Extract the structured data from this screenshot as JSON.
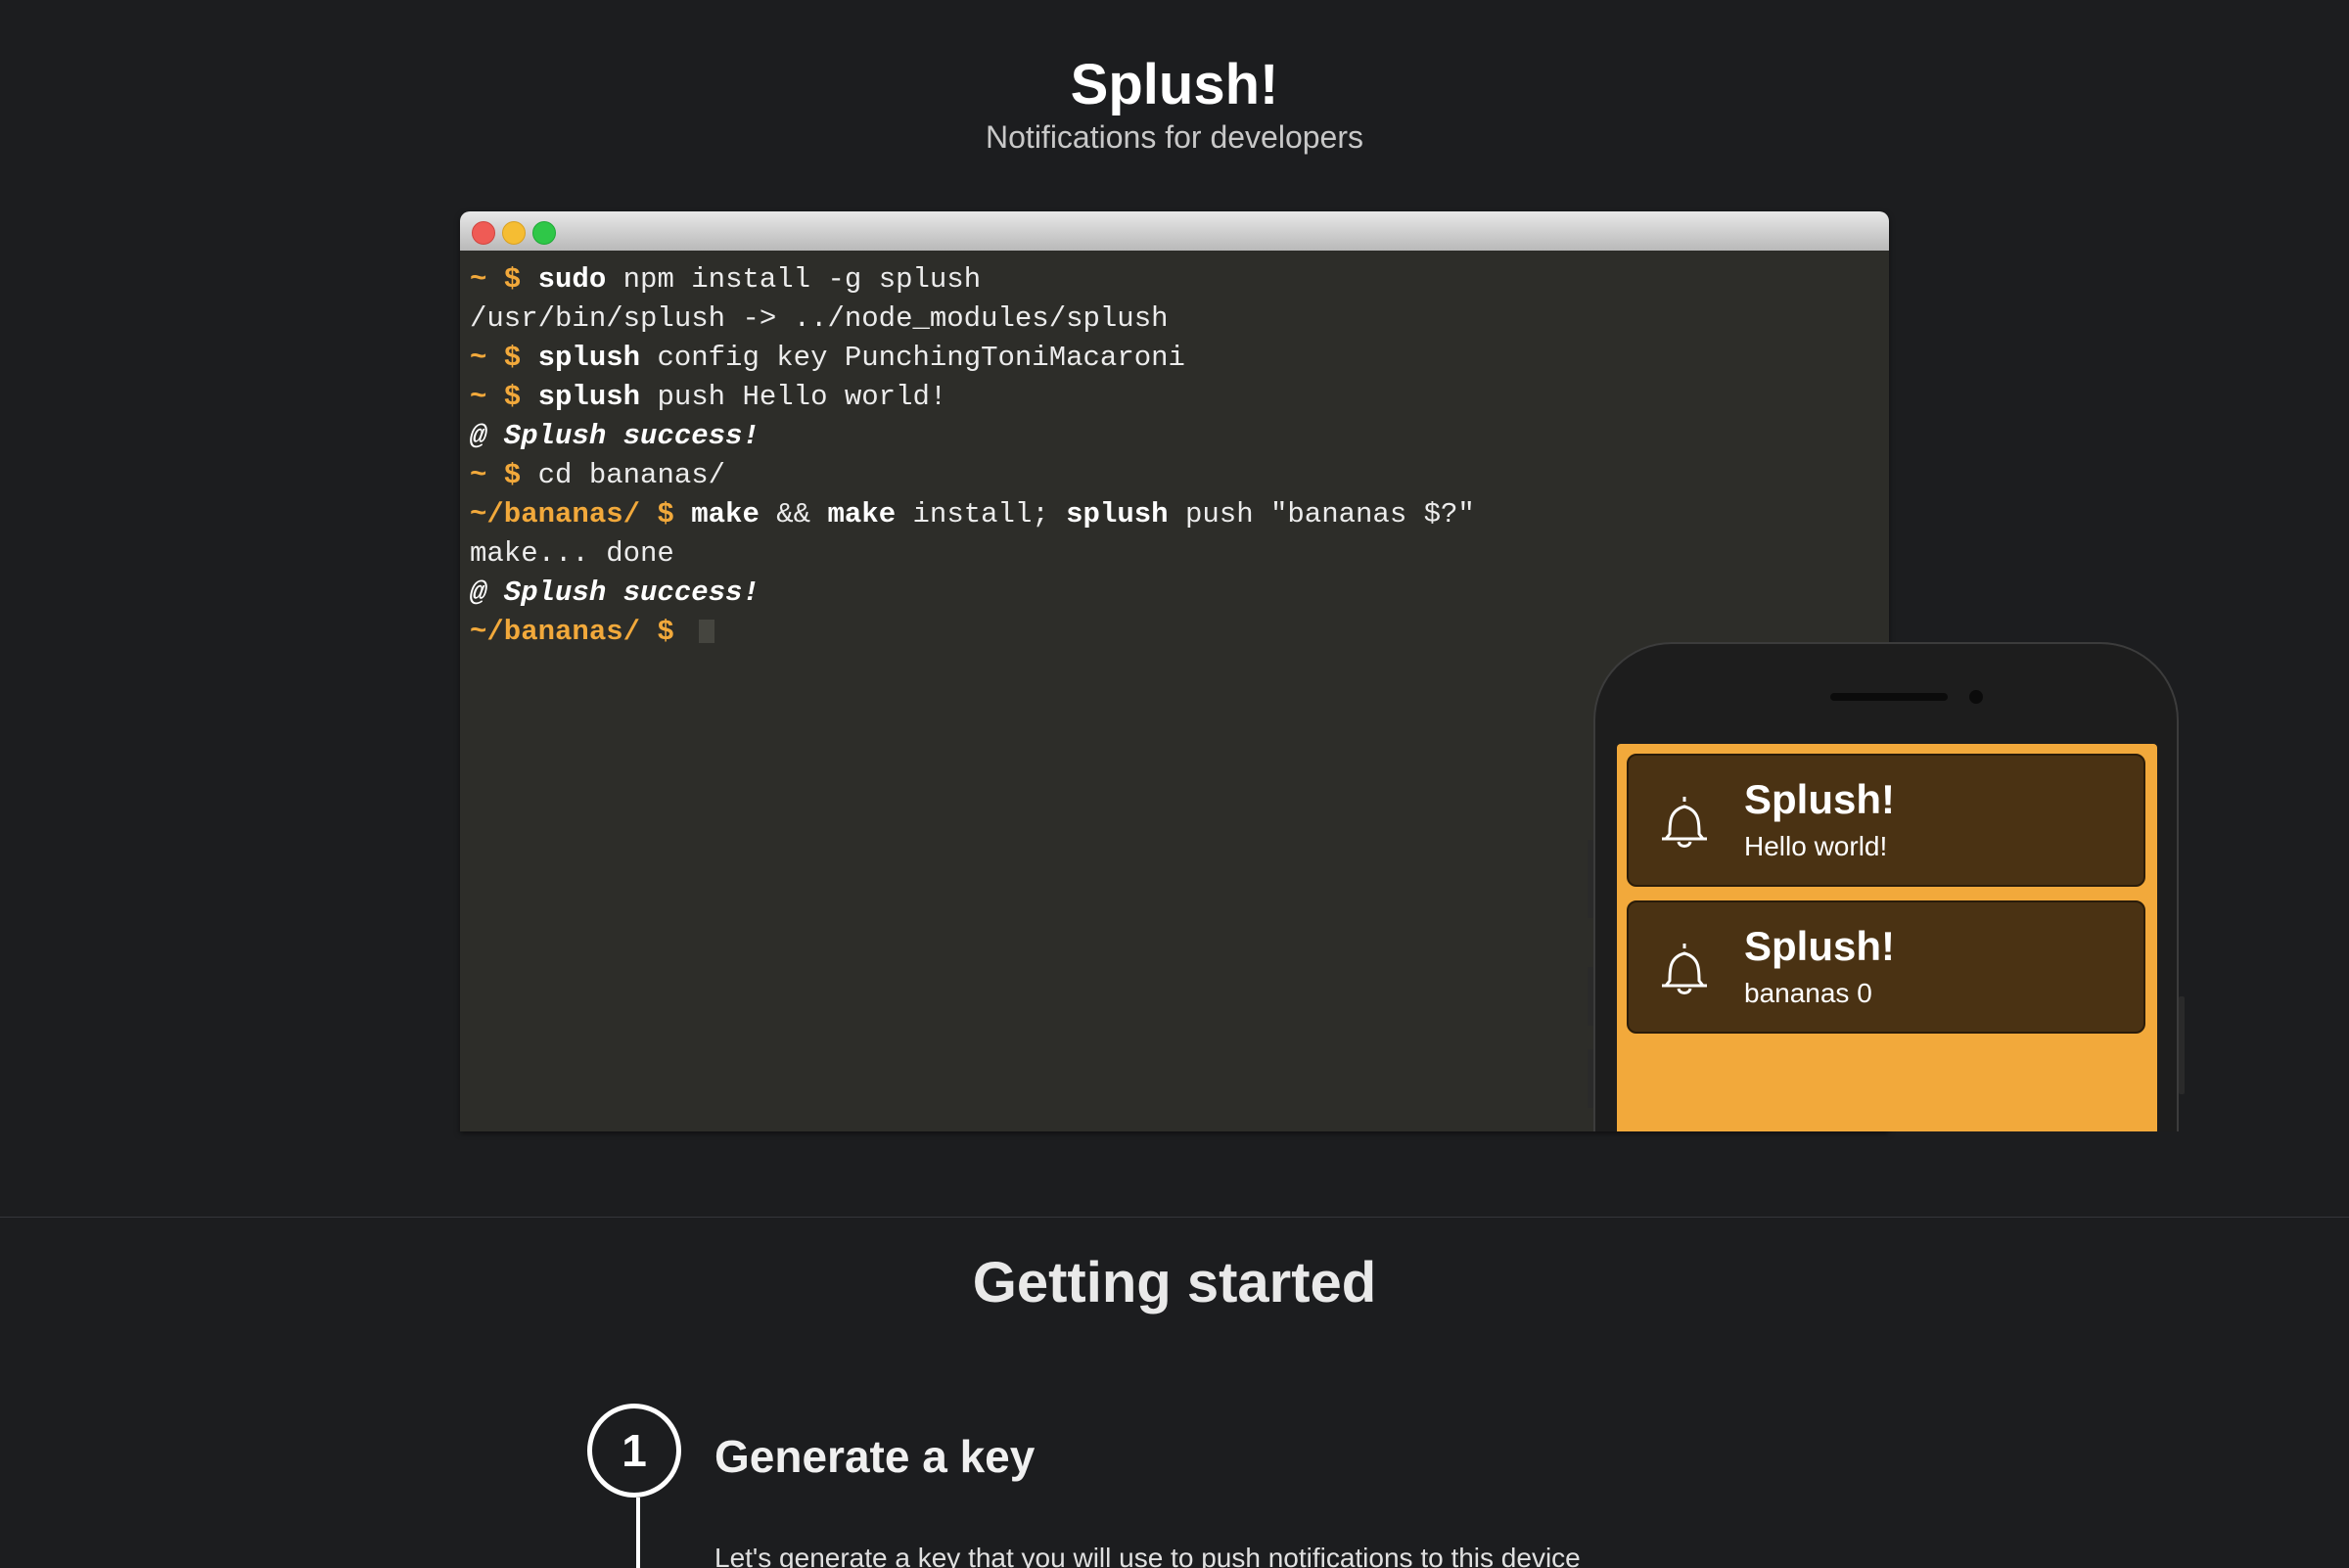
{
  "header": {
    "title": "Splush!",
    "subtitle": "Notifications for developers"
  },
  "terminal": {
    "lines": [
      [
        {
          "k": "prompt",
          "t": "~ $ "
        },
        {
          "k": "cmd",
          "t": "sudo"
        },
        {
          "k": "arg",
          "t": " npm install -g splush"
        }
      ],
      [
        {
          "k": "out",
          "t": "/usr/bin/splush -> ../node_modules/splush"
        }
      ],
      [
        {
          "k": "prompt",
          "t": "~ $ "
        },
        {
          "k": "cmd",
          "t": "splush"
        },
        {
          "k": "arg",
          "t": " config key PunchingToniMacaroni"
        }
      ],
      [
        {
          "k": "prompt",
          "t": "~ $ "
        },
        {
          "k": "cmd",
          "t": "splush"
        },
        {
          "k": "arg",
          "t": " push Hello world!"
        }
      ],
      [
        {
          "k": "success",
          "t": "@ Splush success!"
        }
      ],
      [
        {
          "k": "prompt",
          "t": "~ $ "
        },
        {
          "k": "arg",
          "t": "cd bananas/"
        }
      ],
      [
        {
          "k": "prompt",
          "t": "~/bananas/ $ "
        },
        {
          "k": "cmd",
          "t": "make"
        },
        {
          "k": "arg",
          "t": " && "
        },
        {
          "k": "cmd",
          "t": "make"
        },
        {
          "k": "arg",
          "t": " install; "
        },
        {
          "k": "cmd",
          "t": "splush"
        },
        {
          "k": "arg",
          "t": " push \"bananas $?\""
        }
      ],
      [
        {
          "k": "out",
          "t": "make... done"
        }
      ],
      [
        {
          "k": "success",
          "t": "@ Splush success!"
        }
      ],
      [
        {
          "k": "prompt",
          "t": "~/bananas/ $ "
        },
        {
          "k": "cursor",
          "t": ""
        }
      ]
    ]
  },
  "phone": {
    "notifications": [
      {
        "title": "Splush!",
        "message": "Hello world!",
        "icon": "bell-icon"
      },
      {
        "title": "Splush!",
        "message": "bananas 0",
        "icon": "bell-icon"
      }
    ],
    "screen_color": "#f2a93b"
  },
  "getting_started": {
    "title": "Getting started",
    "steps": [
      {
        "number": "1",
        "title": "Generate a key",
        "description": "Let's generate a key that you will use to push notifications to this device"
      }
    ]
  },
  "colors": {
    "background": "#1c1d1f",
    "accent": "#f2a93b",
    "terminal_bg": "#2d2d29",
    "notification_bg": "#4a3213"
  }
}
